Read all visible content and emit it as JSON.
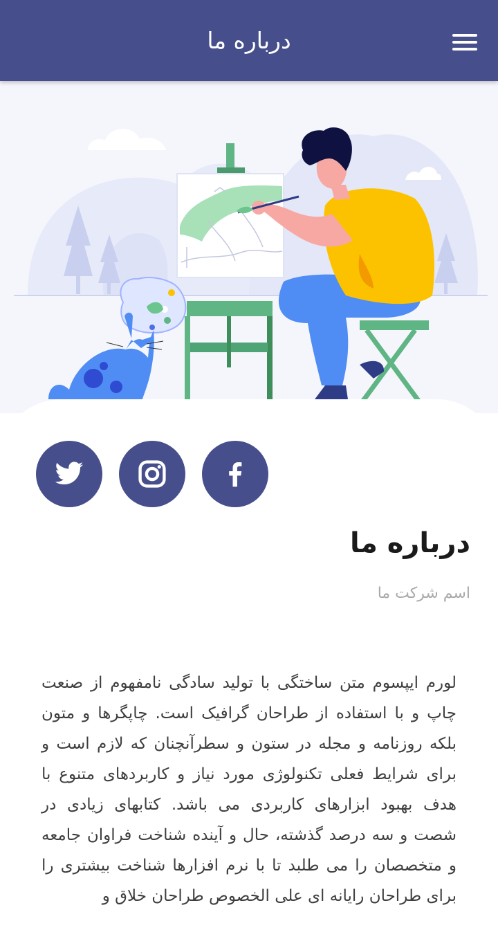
{
  "header": {
    "title": "درباره ما",
    "menu_icon": "hamburger-menu-icon"
  },
  "hero": {
    "illustration": "artist-painting-at-easel-with-cat-illustration"
  },
  "social": [
    {
      "name": "twitter",
      "icon": "twitter-icon"
    },
    {
      "name": "instagram",
      "icon": "instagram-icon"
    },
    {
      "name": "facebook",
      "icon": "facebook-icon"
    }
  ],
  "content": {
    "heading": "درباره ما",
    "subtitle": "اسم شرکت ما",
    "body": "لورم ایپسوم متن ساختگی با تولید سادگی نامفهوم از صنعت چاپ و با استفاده از طراحان گرافیک است. چاپگرها و متون بلکه روزنامه و مجله در ستون و سطرآنچنان که لازم است و برای شرایط فعلی تکنولوژی مورد نیاز و کاربردهای متنوع با هدف بهبود ابزارهای کاربردی می باشد. کتابهای زیادی در شصت و سه درصد گذشته، حال و آینده شناخت فراوان جامعه و متخصصان را می طلبد تا با نرم افزارها شناخت بیشتری را برای طراحان رایانه ای علی الخصوص طراحان خلاق و"
  },
  "colors": {
    "primary": "#464f8c",
    "hero_background": "#f5f6fc",
    "shirt_yellow": "#fcc200",
    "pants_blue": "#4f8df5",
    "easel_green": "#5fb584"
  }
}
